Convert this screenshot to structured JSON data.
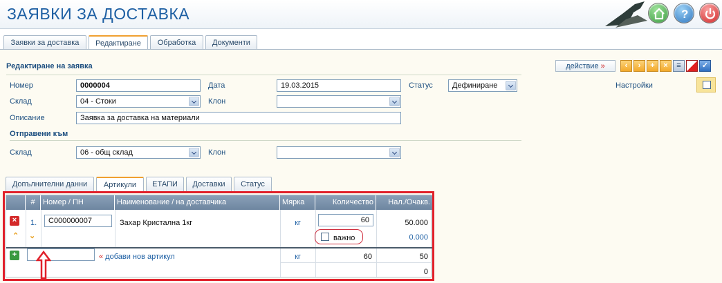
{
  "header": {
    "title": "ЗАЯВКИ ЗА ДОСТАВКА",
    "buttons": [
      "home",
      "help",
      "power"
    ]
  },
  "tabs": [
    {
      "label": "Заявки за доставка"
    },
    {
      "label": "Редактиране"
    },
    {
      "label": "Обработка"
    },
    {
      "label": "Документи"
    }
  ],
  "form": {
    "title": "Редактиране на заявка",
    "action_label": "действие",
    "action_arrow": "»",
    "settings_label": "Настройки",
    "number_label": "Номер",
    "number_value": "0000004",
    "date_label": "Дата",
    "date_value": "19.03.2015",
    "status_label": "Статус",
    "status_value": "Дефиниране",
    "warehouse_label": "Склад",
    "warehouse_value": "04 - Стоки",
    "branch_label": "Клон",
    "branch_value": "",
    "description_label": "Описание",
    "description_value": "Заявка за доставка на материали",
    "sent_to_title": "Отправени към",
    "sent_warehouse_label": "Склад",
    "sent_warehouse_value": "06 - общ склад",
    "sent_branch_label": "Клон",
    "sent_branch_value": ""
  },
  "subtabs": [
    {
      "label": "Допълнителни данни"
    },
    {
      "label": "Артикули"
    },
    {
      "label": "ЕТАПИ"
    },
    {
      "label": "Доставки"
    },
    {
      "label": "Статус"
    }
  ],
  "grid": {
    "columns": [
      "#",
      "Номер / ПН",
      "Наименование / на доставчика",
      "Мярка",
      "Количество",
      "Нал./Очакв."
    ],
    "row": {
      "index": "1.",
      "code": "C000000007",
      "name": "Захар Кристална 1кг",
      "unit": "кг",
      "quantity": "60",
      "available": "50.000",
      "expected": "0.000",
      "important_label": "важно"
    },
    "new_row": {
      "code": "",
      "add_label": "добави нов артикул",
      "add_marker": "«",
      "unit": "кг",
      "quantity": "60",
      "available": "50"
    },
    "total": "0"
  },
  "colors": {
    "accent": "#1d5fa3",
    "highlight": "#e0202a",
    "tab_active": "#f0a030",
    "grid_header": "#7b92ab"
  }
}
